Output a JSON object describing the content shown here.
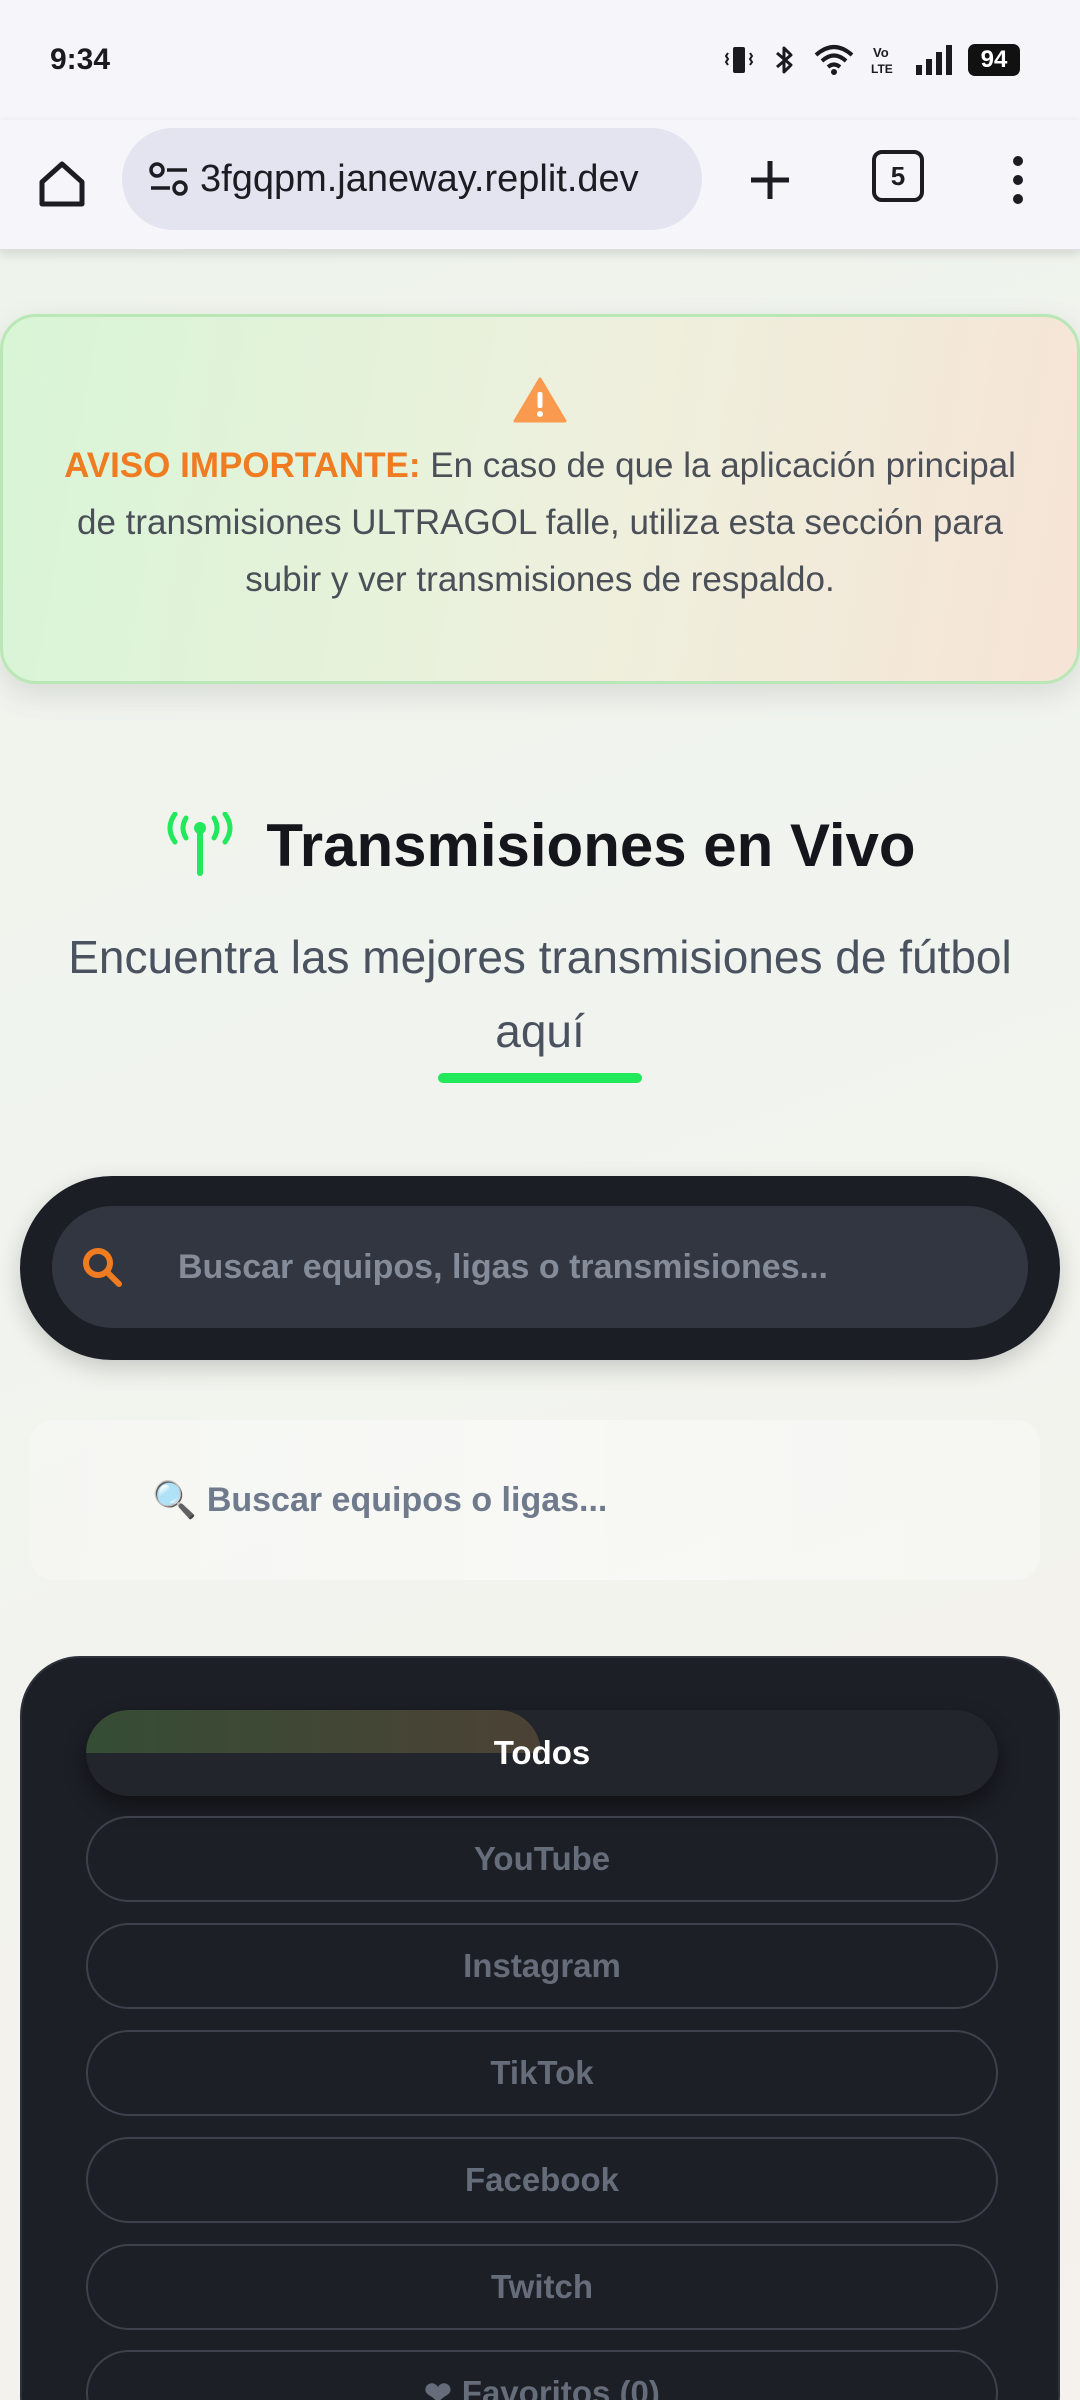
{
  "status_bar": {
    "time": "9:34",
    "battery": "94",
    "icons": [
      "vibrate-icon",
      "bluetooth-icon",
      "wifi-icon",
      "volte-icon",
      "signal-icon",
      "battery-icon"
    ]
  },
  "browser": {
    "url": "3fgqpm.janeway.replit.dev",
    "tab_count": "5",
    "icons": [
      "home-icon",
      "site-settings-icon",
      "new-tab-icon",
      "tabs-icon",
      "menu-icon"
    ]
  },
  "notice": {
    "label": "AVISO IMPORTANTE:",
    "text": " En caso de que la aplicación principal de transmisiones ULTRAGOL falle, utiliza esta sección para subir y ver transmisiones de respaldo.",
    "icon": "warning-icon",
    "label_color": "#f07c22"
  },
  "hero": {
    "title": "Transmisiones en Vivo",
    "subtitle": "Encuentra las mejores transmisiones de fútbol aquí",
    "icon": "antenna-icon",
    "accent": "#22e85c"
  },
  "search": {
    "placeholder": "Buscar equipos, ligas o transmisiones...",
    "value": ""
  },
  "secondary_search": {
    "icon": "🔍",
    "placeholder": "Buscar equipos o ligas...",
    "value": ""
  },
  "filters": {
    "active": "Todos",
    "items": [
      {
        "label": "Todos"
      },
      {
        "label": "YouTube"
      },
      {
        "label": "Instagram"
      },
      {
        "label": "TikTok"
      },
      {
        "label": "Facebook"
      },
      {
        "label": "Twitch"
      },
      {
        "label": "Favoritos (0)"
      }
    ]
  }
}
